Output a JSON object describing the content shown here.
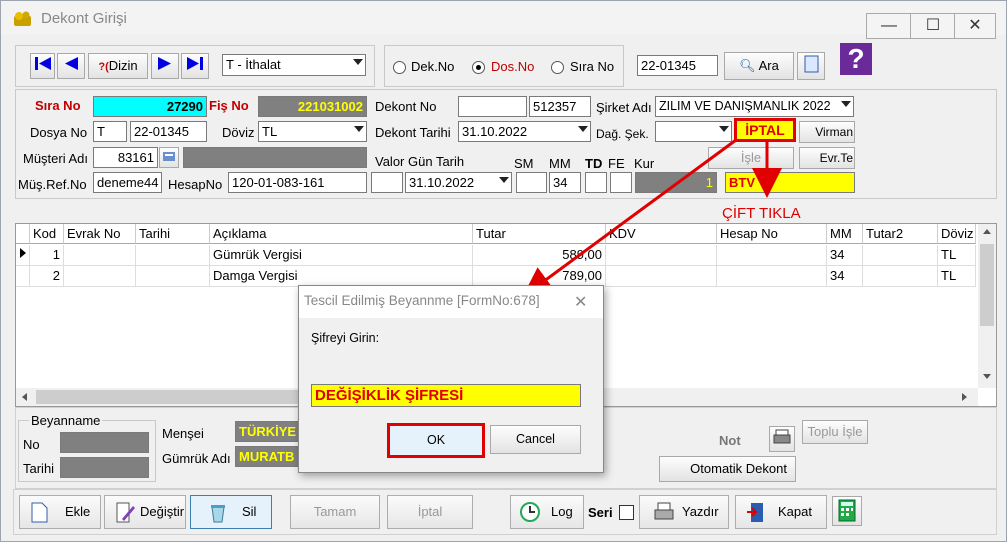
{
  "window": {
    "title": "Dekont Girişi",
    "min": "—",
    "max": "☐",
    "close": "✕"
  },
  "toolbar": {
    "dizin": "Dizin",
    "dizin_prefix": "?(",
    "type_select": "T - İthalat",
    "radio_dek": "Dek.No",
    "radio_dos": "Dos.No",
    "radio_sira": "Sıra No",
    "search_value": "22-01345",
    "search_btn": "Ara",
    "help": "?"
  },
  "form": {
    "sira_no_label": "Sıra No",
    "sira_no": "27290",
    "fis_no_label": "Fiş No",
    "fis_no": "221031002",
    "dekont_no_label": "Dekont No",
    "dekont_no_a": "",
    "dekont_no_b": "512357",
    "sirket_label": "Şirket Adı",
    "sirket": "ZILIM  VE DANIŞMANLIK 2022",
    "dosya_no_label": "Dosya No",
    "dosya_prefix": "T",
    "dosya_no": "22-01345",
    "doviz_label": "Döviz",
    "doviz": "TL",
    "dekont_tarihi_label": "Dekont Tarihi",
    "dekont_tarihi": "31.10.2022",
    "dag_sek_label": "Dağ. Şek.",
    "dag_sek": "",
    "iptal_badge": "İPTAL",
    "virman": "Virman",
    "isle": "İşle",
    "evr_te": "Evr.Te",
    "musteri_label": "Müşteri Adı",
    "musteri_kod": "83161",
    "musteri_ad": "",
    "valor_label": "Valor Gün Tarih",
    "sm_label": "SM",
    "mm_label": "MM",
    "td_label": "TD",
    "fe_label": "FE",
    "kur_label": "Kur",
    "mus_ref_label": "Müş.Ref.No",
    "mus_ref": "deneme44",
    "hesapno_label": "HesapNo",
    "hesapno": "120-01-083-161",
    "valor_gun": "",
    "valor_tarih": "31.10.2022",
    "sm": "",
    "mm": "34",
    "td": "",
    "fe": "",
    "kur": "1",
    "btv": "BTV"
  },
  "annotation": {
    "cift_tikla": "ÇİFT TIKLA"
  },
  "grid": {
    "columns": [
      "Kod",
      "Evrak No",
      "Tarihi",
      "Açıklama",
      "Tutar",
      "KDV",
      "Hesap No",
      "MM",
      "Tutar2",
      "Döviz"
    ],
    "rows": [
      {
        "kod": "1",
        "evrak": "",
        "tarih": "",
        "aciklama": "Gümrük Vergisi",
        "tutar": "589,00",
        "kdv": "",
        "hesap": "",
        "mm": "34",
        "tutar2": "",
        "doviz": "TL"
      },
      {
        "kod": "2",
        "evrak": "",
        "tarih": "",
        "aciklama": "Damga Vergisi",
        "tutar": "789,00",
        "kdv": "",
        "hesap": "",
        "mm": "34",
        "tutar2": "",
        "doviz": "TL"
      }
    ]
  },
  "beyanname": {
    "title": "Beyanname",
    "no_label": "No",
    "tarihi_label": "Tarihi",
    "mensei_label": "Menşei",
    "mensei": "TÜRKİYE",
    "gumruk_label": "Gümrük Adı",
    "gumruk": "MURATB",
    "not_label": "Not",
    "toplu": "Toplu İşle",
    "otomatik": "Otomatik Dekont"
  },
  "bottom": {
    "ekle": "Ekle",
    "degistir": "Değiştir",
    "sil": "Sil",
    "tamam": "Tamam",
    "iptal": "İptal",
    "log": "Log",
    "seri": "Seri",
    "yazdir": "Yazdır",
    "kapat": "Kapat"
  },
  "dialog": {
    "title": "Tescil Edilmiş Beyannme [FormNo:678]",
    "prompt": "Şifreyi Girin:",
    "password": "DEĞİŞİKLİK ŞİFRESİ",
    "ok": "OK",
    "cancel": "Cancel",
    "close": "✕"
  },
  "colors": {
    "highlight_yellow": "#ffff00",
    "cyan": "#00ffff",
    "annotation_red": "#e00000",
    "disabled_gray": "#808080",
    "yellow_field": "#ffff00"
  }
}
